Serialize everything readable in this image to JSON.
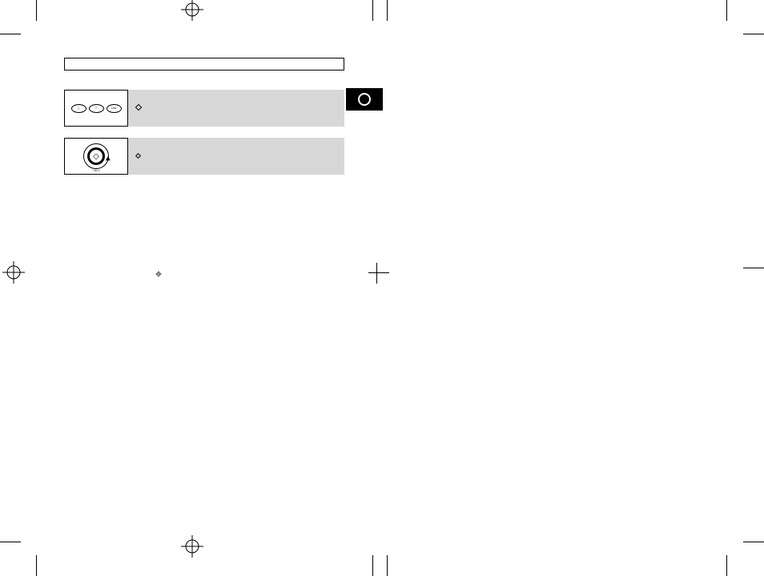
{
  "title": "",
  "tab": {
    "symbol": "circle"
  },
  "steps": [
    {
      "icon_type": "three-ovals",
      "ovals": [
        {
          "symbol": "△",
          "label": ""
        },
        {
          "symbol": "▽",
          "label": ""
        },
        {
          "symbol": "",
          "label": "10s"
        }
      ],
      "text_line1": "",
      "text_line2": "",
      "inline_glyph": "diamond"
    },
    {
      "icon_type": "dial",
      "dial_symbol": "◇",
      "dial_label": "+30 s",
      "text_line1": "",
      "inline_glyph": "circle-small"
    }
  ],
  "registration_marks": true,
  "footer": ""
}
